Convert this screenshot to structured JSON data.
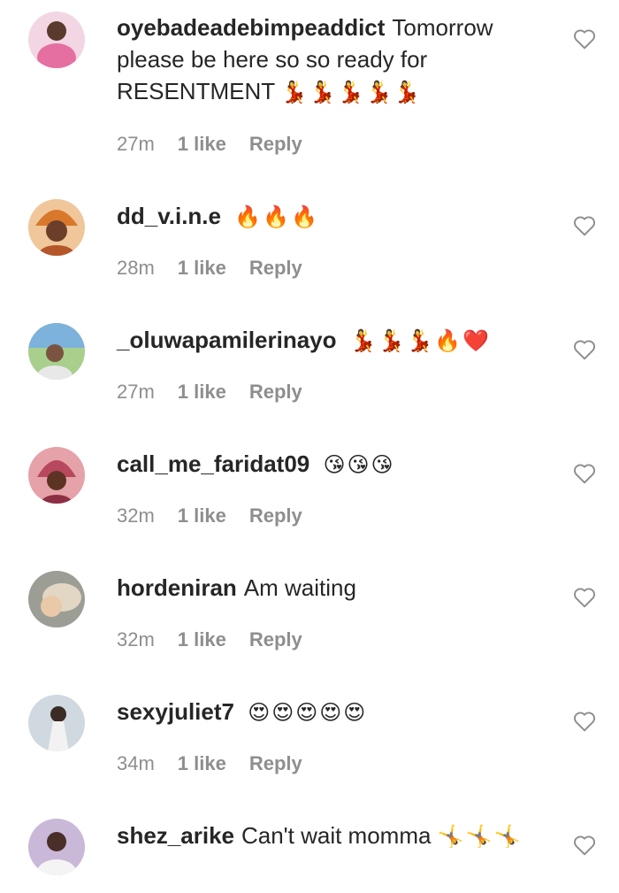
{
  "comments": [
    {
      "username": "oyebadeadebimpeaddict",
      "text": "Tomorrow please be here so so ready for RESENTMENT",
      "emoji": "💃💃💃💃💃",
      "time": "27m",
      "likes": "1 like",
      "reply": "Reply",
      "avatar_color": "#e56fa0"
    },
    {
      "username": "dd_v.i.n.e",
      "text": "",
      "emoji": "🔥🔥🔥",
      "time": "28m",
      "likes": "1 like",
      "reply": "Reply",
      "avatar_color": "#d9782a"
    },
    {
      "username": "_oluwapamilerinayo",
      "text": "",
      "emoji": "💃💃💃🔥❤️",
      "time": "27m",
      "likes": "1 like",
      "reply": "Reply",
      "avatar_color": "#5fa3d6"
    },
    {
      "username": "call_me_faridat09",
      "text": "",
      "emoji": "😘😘😘",
      "time": "32m",
      "likes": "1 like",
      "reply": "Reply",
      "avatar_color": "#b8485e"
    },
    {
      "username": "hordeniran",
      "text": "Am waiting",
      "emoji": "",
      "time": "32m",
      "likes": "1 like",
      "reply": "Reply",
      "avatar_color": "#c9b9a6"
    },
    {
      "username": "sexyjuliet7",
      "text": "",
      "emoji": "😍😍😍😍😍",
      "time": "34m",
      "likes": "1 like",
      "reply": "Reply",
      "avatar_color": "#cfd9df"
    },
    {
      "username": "shez_arike",
      "text": "Can't wait momma",
      "emoji": "🤸🤸🤸",
      "time": "",
      "likes": "",
      "reply": "",
      "avatar_color": "#7a4a8f"
    }
  ],
  "icons": {
    "like": "heart-outline-icon"
  }
}
